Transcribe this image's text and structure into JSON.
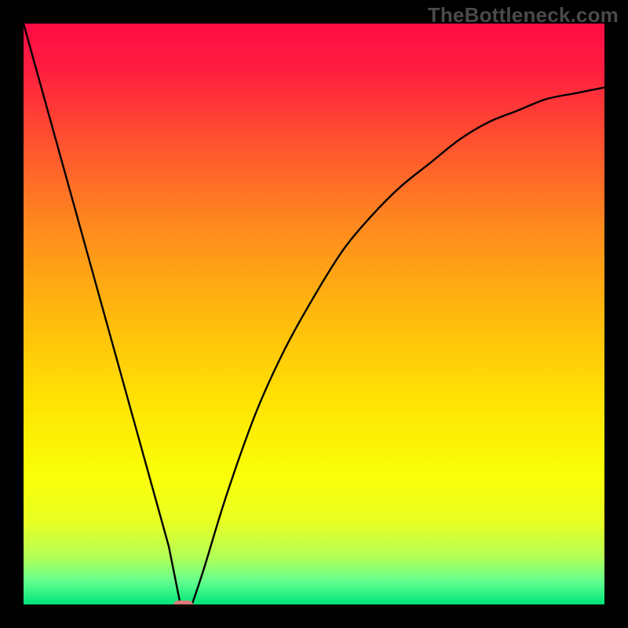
{
  "watermark": "TheBottleneck.com",
  "chart_data": {
    "type": "line",
    "title": "",
    "xlabel": "",
    "ylabel": "",
    "xlim": [
      0,
      1
    ],
    "ylim": [
      0,
      1
    ],
    "x": [
      0.0,
      0.05,
      0.1,
      0.15,
      0.2,
      0.25,
      0.27,
      0.29,
      0.31,
      0.35,
      0.4,
      0.45,
      0.5,
      0.55,
      0.6,
      0.65,
      0.7,
      0.75,
      0.8,
      0.85,
      0.9,
      0.95,
      1.0
    ],
    "values": [
      1.0,
      0.82,
      0.64,
      0.46,
      0.28,
      0.1,
      0.0,
      0.0,
      0.06,
      0.19,
      0.33,
      0.44,
      0.53,
      0.61,
      0.67,
      0.72,
      0.76,
      0.8,
      0.83,
      0.85,
      0.87,
      0.88,
      0.89
    ],
    "annotations": [
      {
        "type": "marker",
        "x": 0.275,
        "y": 0.0,
        "shape": "rounded-rect",
        "color": "#dd7b7b"
      }
    ],
    "background": {
      "type": "vertical-gradient",
      "stops": [
        {
          "offset": 0.0,
          "color": "#ff0b44"
        },
        {
          "offset": 0.08,
          "color": "#ff1e3f"
        },
        {
          "offset": 0.2,
          "color": "#ff5030"
        },
        {
          "offset": 0.35,
          "color": "#ff8a1e"
        },
        {
          "offset": 0.5,
          "color": "#ffb90d"
        },
        {
          "offset": 0.65,
          "color": "#ffe304"
        },
        {
          "offset": 0.78,
          "color": "#faff08"
        },
        {
          "offset": 0.86,
          "color": "#e7ff24"
        },
        {
          "offset": 0.92,
          "color": "#b0ff57"
        },
        {
          "offset": 0.96,
          "color": "#63ff8f"
        },
        {
          "offset": 1.0,
          "color": "#00e47a"
        }
      ]
    }
  }
}
